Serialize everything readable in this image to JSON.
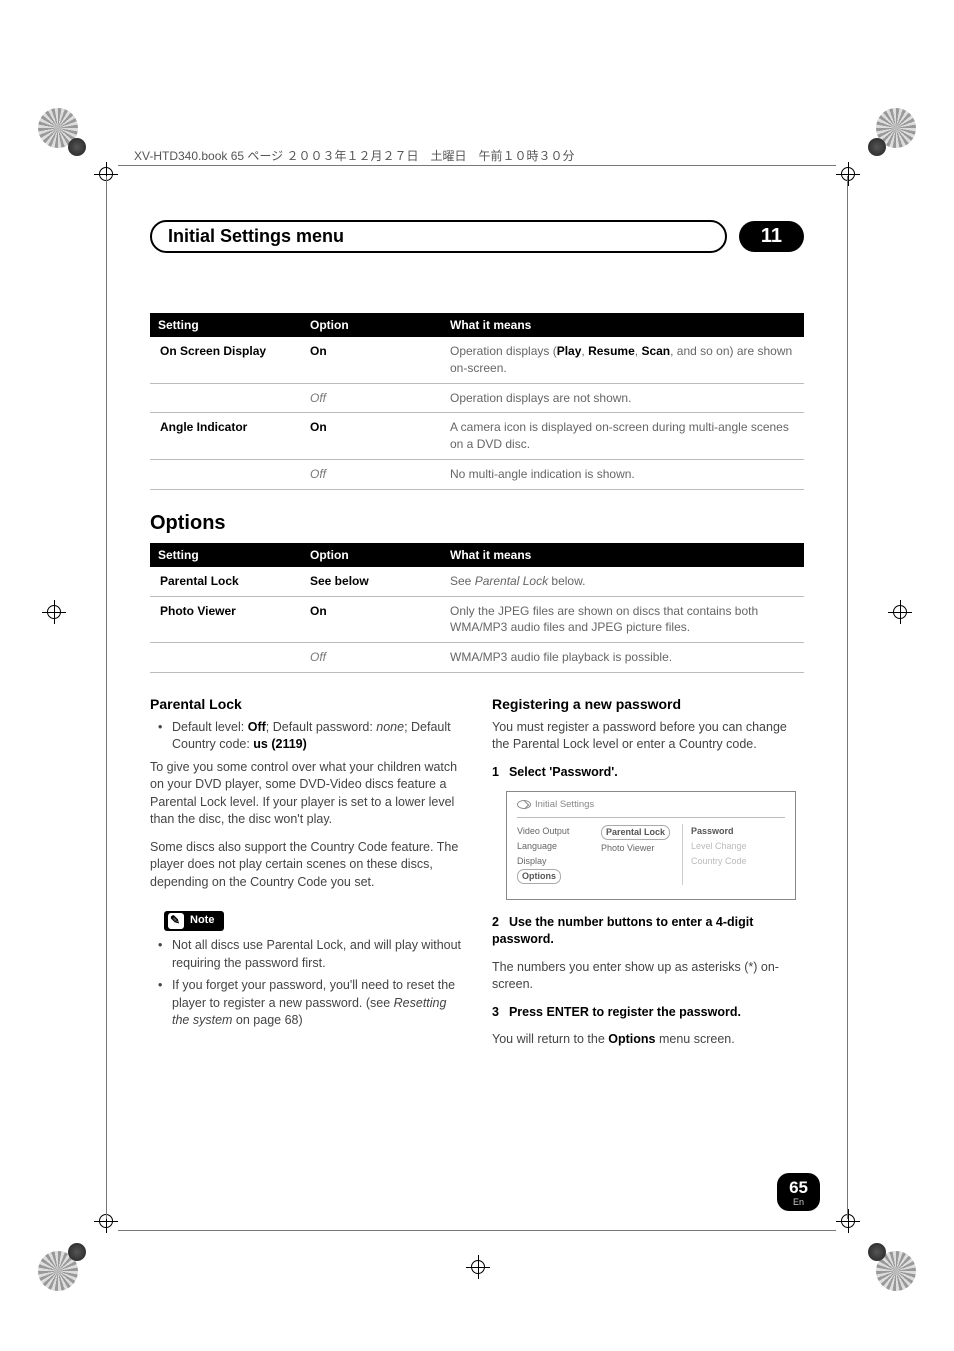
{
  "header_jp": "XV-HTD340.book 65 ページ ２００３年１２月２７日　土曜日　午前１０時３０分",
  "title": "Initial Settings menu",
  "chapter": "11",
  "table1": {
    "headers": [
      "Setting",
      "Option",
      "What it means"
    ],
    "rows": [
      {
        "setting": "On Screen Display",
        "option": "On",
        "option_italic": false,
        "meaning_parts": [
          "Operation displays (",
          "Play",
          ", ",
          "Resume",
          ", ",
          "Scan",
          ", and so on) are shown on-screen."
        ]
      },
      {
        "setting": "",
        "option": "Off",
        "option_italic": true,
        "meaning": "Operation displays are not shown."
      },
      {
        "setting": "Angle Indicator",
        "option": "On",
        "option_italic": false,
        "meaning": "A camera icon is displayed on-screen during multi-angle scenes on a DVD disc."
      },
      {
        "setting": "",
        "option": "Off",
        "option_italic": true,
        "meaning": "No multi-angle indication is shown."
      }
    ]
  },
  "options_heading": "Options",
  "table2": {
    "headers": [
      "Setting",
      "Option",
      "What it means"
    ],
    "rows": [
      {
        "setting": "Parental Lock",
        "option": "See below",
        "option_italic": false,
        "meaning_parts": [
          "See ",
          "Parental Lock",
          " below."
        ]
      },
      {
        "setting": "Photo Viewer",
        "option": "On",
        "option_italic": false,
        "meaning": "Only the JPEG files are shown on discs that contains both WMA/MP3 audio files and JPEG picture files."
      },
      {
        "setting": "",
        "option": "Off",
        "option_italic": true,
        "meaning": "WMA/MP3 audio file playback is possible."
      }
    ]
  },
  "left": {
    "heading": "Parental Lock",
    "bullet_prefix": "Default level: ",
    "bullet_off": "Off",
    "bullet_mid": "; Default password: ",
    "bullet_none": "none",
    "bullet_suffix": "; Default Country code: ",
    "bullet_us": "us (2119)",
    "para1": "To give you some control over what your children watch on your DVD player, some DVD-Video discs feature a Parental Lock level. If your player is set to a lower level than the disc, the disc won't play.",
    "para2": "Some discs also support the Country Code feature. The player does not play certain scenes on these discs, depending on the Country Code you set.",
    "note_label": "Note",
    "note1": "Not all discs use Parental Lock, and will play without requiring the password first.",
    "note2_pre": "If you forget your password, you'll need to reset the player to register a new password. (see ",
    "note2_italic": "Resetting the system",
    "note2_post": " on page 68)"
  },
  "right": {
    "heading": "Registering a new password",
    "intro": "You must register a password before you can change the Parental Lock level or enter a Country code.",
    "step1": "Select 'Password'.",
    "ui": {
      "title": "Initial Settings",
      "left": [
        "Video Output",
        "Language",
        "Display",
        "Options"
      ],
      "left_selected_index": 3,
      "mid": [
        "Parental Lock",
        "Photo Viewer"
      ],
      "mid_selected_index": 0,
      "right": [
        {
          "label": "Password",
          "active": true
        },
        {
          "label": "Level Change",
          "active": false
        },
        {
          "label": "Country Code",
          "active": false
        }
      ]
    },
    "step2_title": "Use the number buttons to enter a 4-digit password.",
    "step2_body": "The numbers you enter show up as asterisks (*) on-screen.",
    "step3_title": "Press ENTER to register the password.",
    "step3_body_pre": "You will return to the ",
    "step3_body_bold": "Options",
    "step3_body_post": " menu screen."
  },
  "page": {
    "num": "65",
    "lang": "En"
  }
}
